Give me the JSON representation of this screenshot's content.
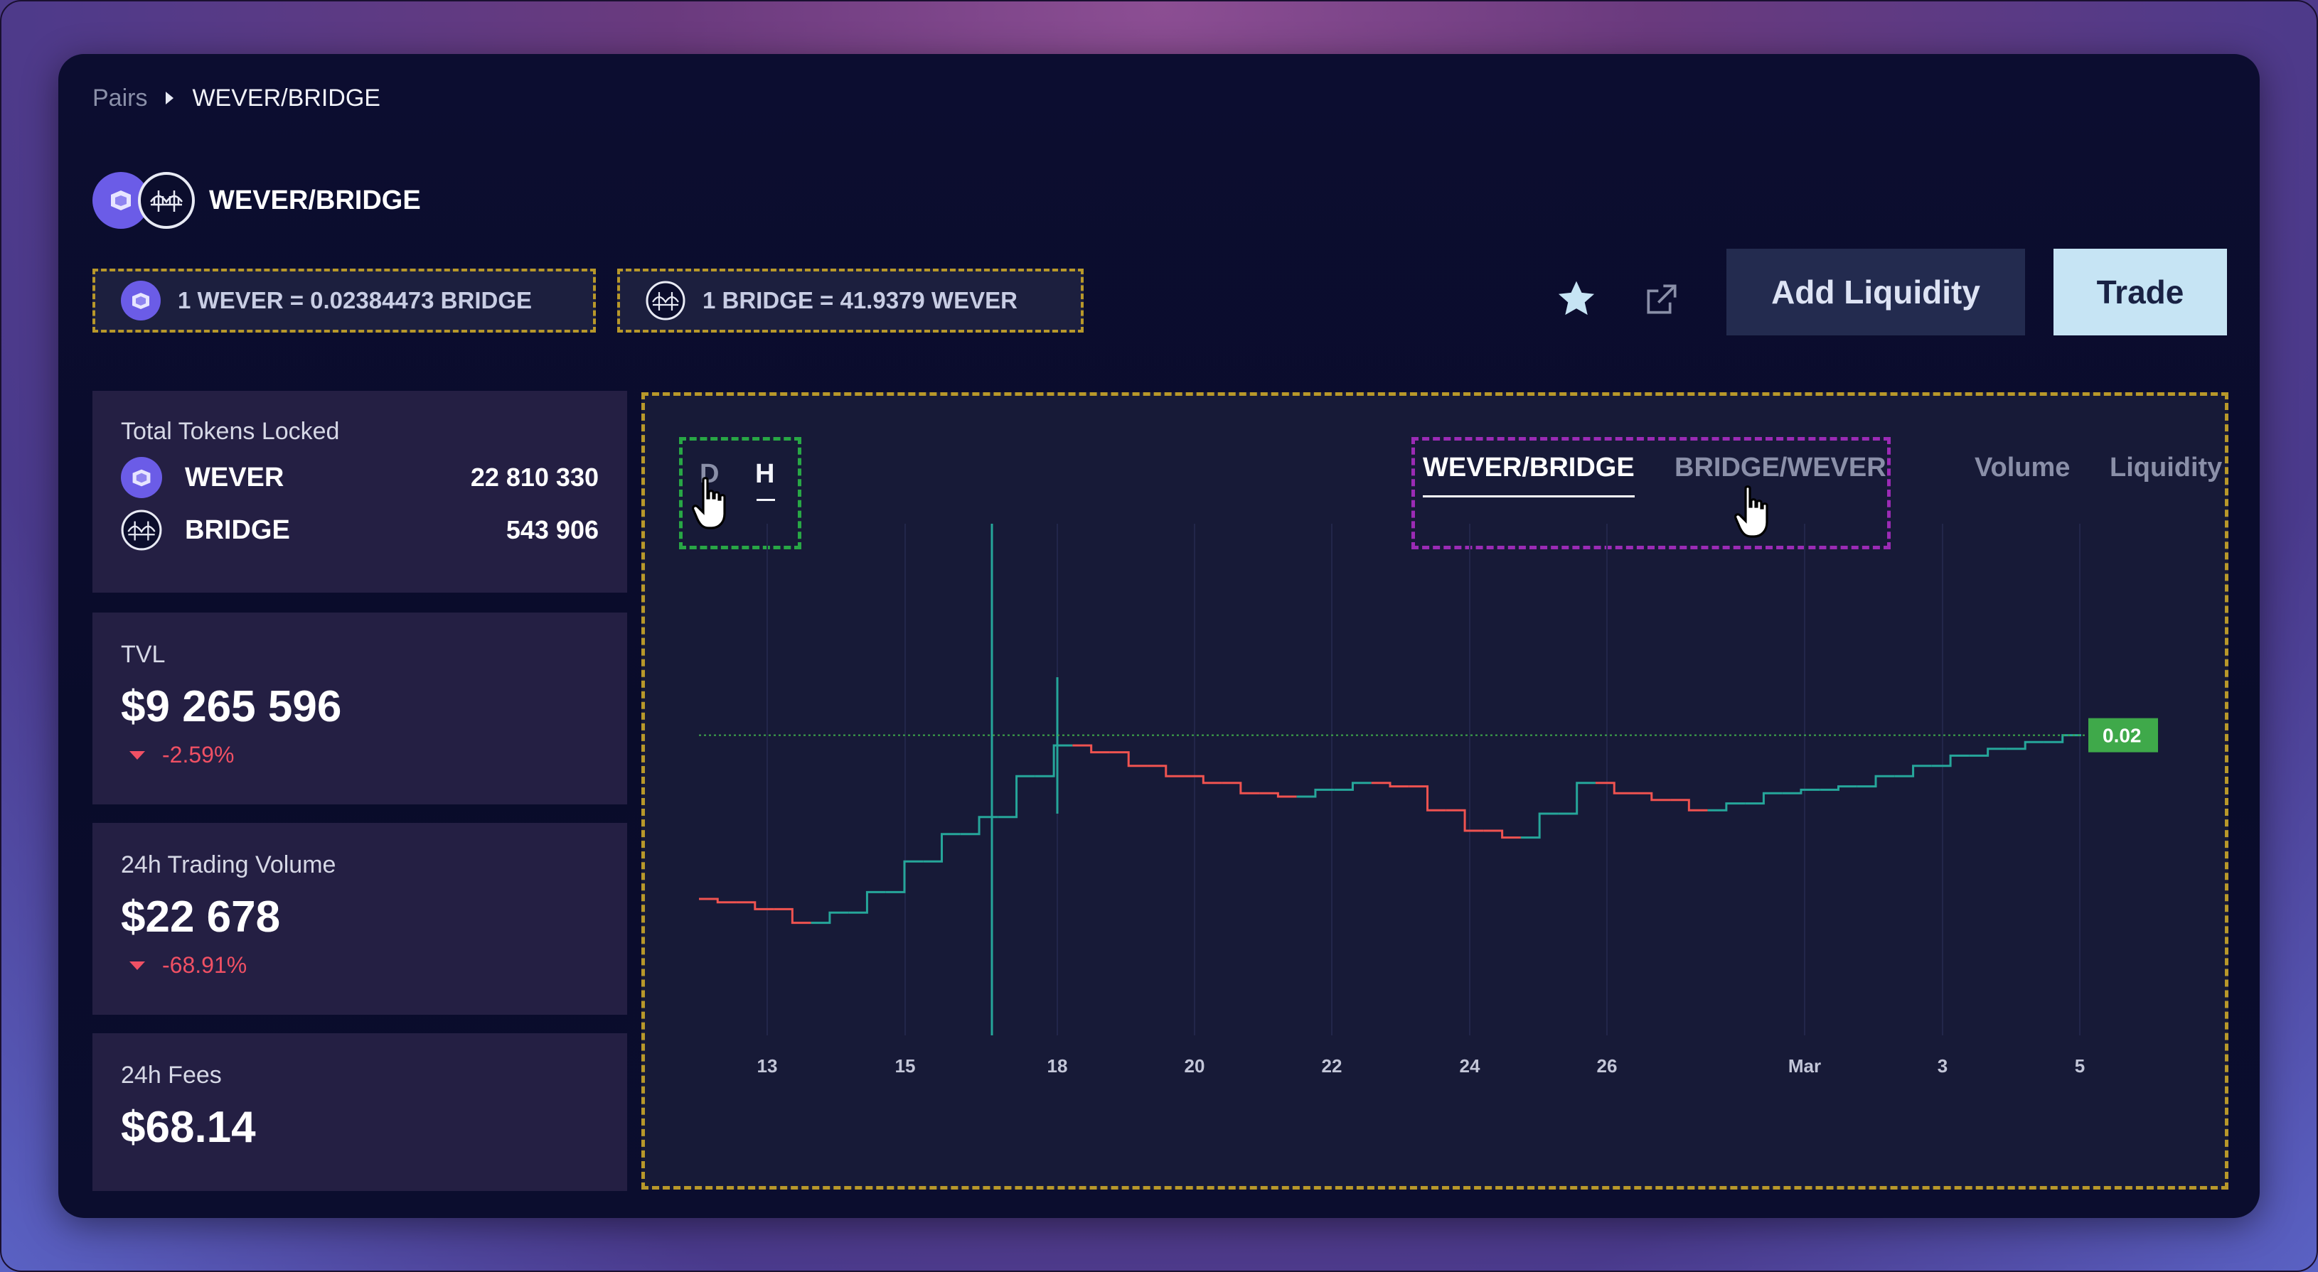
{
  "breadcrumb": {
    "root": "Pairs",
    "current": "WEVER/BRIDGE"
  },
  "pair": {
    "title": "WEVER/BRIDGE",
    "price_a": "1 WEVER = 0.02384473 BRIDGE",
    "price_b": "1 BRIDGE = 41.9379 WEVER"
  },
  "actions": {
    "add_liquidity": "Add Liquidity",
    "trade": "Trade"
  },
  "stats": {
    "total_locked": {
      "label": "Total Tokens Locked",
      "tokens": [
        {
          "symbol": "WEVER",
          "amount": "22 810 330"
        },
        {
          "symbol": "BRIDGE",
          "amount": "543 906"
        }
      ]
    },
    "tvl": {
      "label": "TVL",
      "value": "$9 265 596",
      "change": "-2.59%"
    },
    "volume": {
      "label": "24h Trading Volume",
      "value": "$22 678",
      "change": "-68.91%"
    },
    "fees": {
      "label": "24h Fees",
      "value": "$68.14"
    }
  },
  "chart": {
    "ranges": [
      "D",
      "H"
    ],
    "selected_range": "H",
    "tabs": [
      "WEVER/BRIDGE",
      "BRIDGE/WEVER",
      "Volume",
      "Liquidity"
    ],
    "active_tab": "WEVER/BRIDGE",
    "current_price_label": "0.02"
  },
  "colors": {
    "up": "#26a69a",
    "down": "#ef5350",
    "price_tag": "#3fa94a",
    "accent": "#6b5ce7"
  },
  "chart_data": {
    "type": "line",
    "x_ticks": [
      "13",
      "15",
      "18",
      "20",
      "22",
      "24",
      "26",
      "Mar",
      "3",
      "5"
    ],
    "current_price": 0.02,
    "grid": true,
    "series": [
      {
        "values": [
          0.019,
          0.0189,
          0.0187,
          0.0183,
          0.0186,
          0.0192,
          0.0201,
          0.0209,
          0.0214,
          0.0226,
          0.0235,
          0.0233,
          0.0229,
          0.0226,
          0.0224,
          0.0221,
          0.022,
          0.0222,
          0.0224,
          0.0223,
          0.0216,
          0.021,
          0.0208,
          0.0215,
          0.0224,
          0.0221,
          0.0219,
          0.0216,
          0.0218,
          0.0221,
          0.0222,
          0.0223,
          0.0226,
          0.0229,
          0.0232,
          0.0234,
          0.0236,
          0.0238
        ]
      }
    ]
  }
}
